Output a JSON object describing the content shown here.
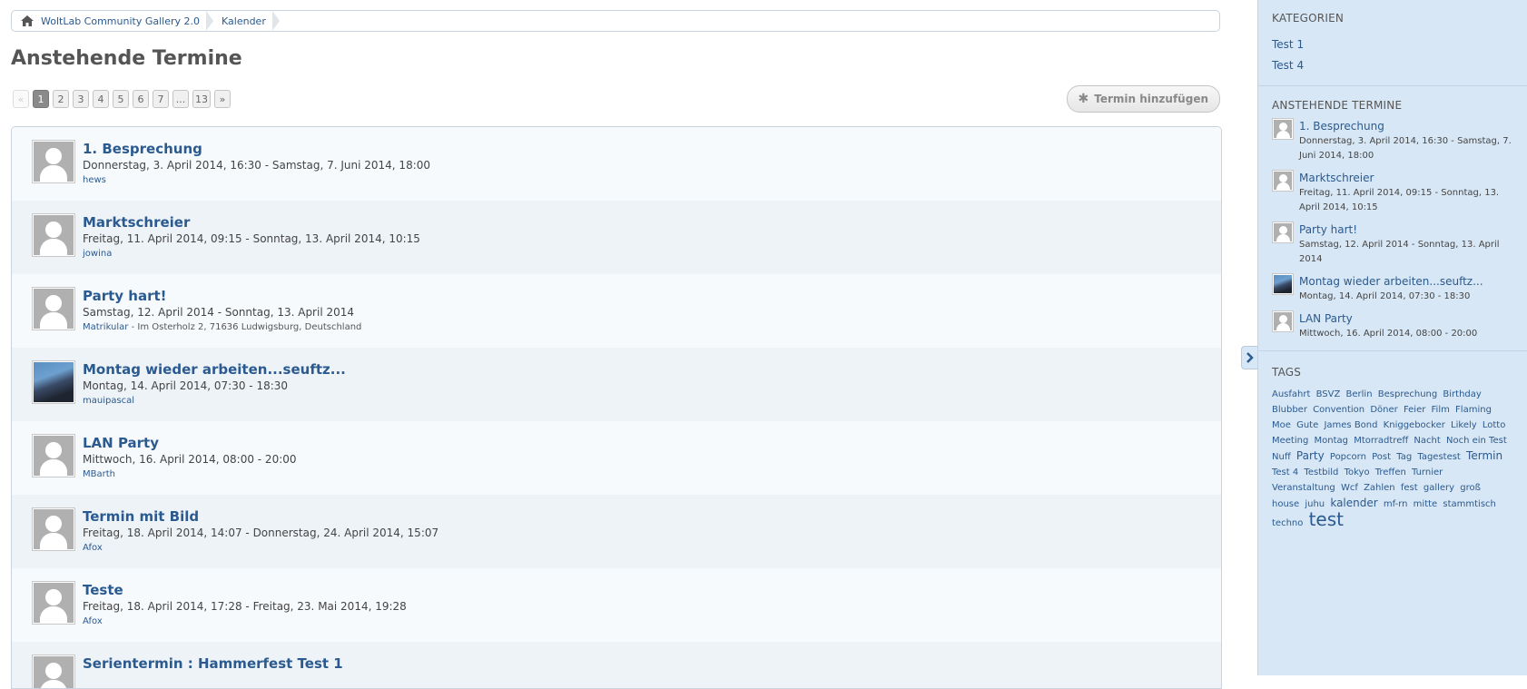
{
  "breadcrumb": {
    "items": [
      "WoltLab Community Gallery 2.0",
      "Kalender"
    ]
  },
  "page_title": "Anstehende Termine",
  "pagination": {
    "prev": "«",
    "pages": [
      "1",
      "2",
      "3",
      "4",
      "5",
      "6",
      "7",
      "...",
      "13"
    ],
    "active": "1",
    "next": "»"
  },
  "add_button": {
    "icon": "asterisk-icon",
    "label": "Termin hinzufügen"
  },
  "events": [
    {
      "title": "1. Besprechung",
      "date": "Donnerstag, 3. April 2014, 16:30 - Samstag, 7. Juni 2014, 18:00",
      "author": "hews",
      "location": ""
    },
    {
      "title": "Marktschreier",
      "date": "Freitag, 11. April 2014, 09:15 - Sonntag, 13. April 2014, 10:15",
      "author": "jowina",
      "location": ""
    },
    {
      "title": "Party hart!",
      "date": "Samstag, 12. April 2014 - Sonntag, 13. April 2014",
      "author": "Matrikular",
      "location": "- Im Osterholz 2, 71636 Ludwigsburg, Deutschland"
    },
    {
      "title": "Montag wieder arbeiten...seuftz...",
      "date": "Montag, 14. April 2014, 07:30 - 18:30",
      "author": "mauipascal",
      "location": ""
    },
    {
      "title": "LAN Party",
      "date": "Mittwoch, 16. April 2014, 08:00 - 20:00",
      "author": "MBarth",
      "location": ""
    },
    {
      "title": "Termin mit Bild",
      "date": "Freitag, 18. April 2014, 14:07 - Donnerstag, 24. April 2014, 15:07",
      "author": "Afox",
      "location": ""
    },
    {
      "title": "Teste",
      "date": "Freitag, 18. April 2014, 17:28 - Freitag, 23. Mai 2014, 19:28",
      "author": "Afox",
      "location": ""
    },
    {
      "title": "Serientermin : Hammerfest Test 1",
      "date": "",
      "author": "",
      "location": ""
    }
  ],
  "sidebar": {
    "categories_heading": "KATEGORIEN",
    "categories": [
      "Test 1",
      "Test 4"
    ],
    "upcoming_heading": "ANSTEHENDE TERMINE",
    "upcoming": [
      {
        "title": "1. Besprechung",
        "date": "Donnerstag, 3. April 2014, 16:30 - Samstag, 7. Juni 2014, 18:00"
      },
      {
        "title": "Marktschreier",
        "date": "Freitag, 11. April 2014, 09:15 - Sonntag, 13. April 2014, 10:15"
      },
      {
        "title": "Party hart!",
        "date": "Samstag, 12. April 2014 - Sonntag, 13. April 2014"
      },
      {
        "title": "Montag wieder arbeiten...seuftz...",
        "date": "Montag, 14. April 2014, 07:30 - 18:30"
      },
      {
        "title": "LAN Party",
        "date": "Mittwoch, 16. April 2014, 08:00 - 20:00"
      }
    ],
    "tags_heading": "TAGS",
    "tags": [
      {
        "t": "Ausfahrt",
        "s": 1
      },
      {
        "t": "BSVZ",
        "s": 1
      },
      {
        "t": "Berlin",
        "s": 1
      },
      {
        "t": "Besprechung",
        "s": 1
      },
      {
        "t": "Birthday",
        "s": 1
      },
      {
        "t": "Blubber",
        "s": 1
      },
      {
        "t": "Convention",
        "s": 1
      },
      {
        "t": "Döner",
        "s": 1
      },
      {
        "t": "Feier",
        "s": 1
      },
      {
        "t": "Film",
        "s": 1
      },
      {
        "t": "Flaming Moe",
        "s": 1
      },
      {
        "t": "Gute",
        "s": 1
      },
      {
        "t": "James Bond",
        "s": 1
      },
      {
        "t": "Kniggebocker",
        "s": 1
      },
      {
        "t": "Likely",
        "s": 1
      },
      {
        "t": "Lotto",
        "s": 1
      },
      {
        "t": "Meeting",
        "s": 1
      },
      {
        "t": "Montag",
        "s": 1
      },
      {
        "t": "Mtorradtreff",
        "s": 1
      },
      {
        "t": "Nacht",
        "s": 1
      },
      {
        "t": "Noch ein Test",
        "s": 1
      },
      {
        "t": "Nuff",
        "s": 1
      },
      {
        "t": "Party",
        "s": 2
      },
      {
        "t": "Popcorn",
        "s": 1
      },
      {
        "t": "Post",
        "s": 1
      },
      {
        "t": "Tag",
        "s": 1
      },
      {
        "t": "Tagestest",
        "s": 1
      },
      {
        "t": "Termin",
        "s": 2
      },
      {
        "t": "Test 4",
        "s": 1
      },
      {
        "t": "Testbild",
        "s": 1
      },
      {
        "t": "Tokyo",
        "s": 1
      },
      {
        "t": "Treffen",
        "s": 1
      },
      {
        "t": "Turnier",
        "s": 1
      },
      {
        "t": "Veranstaltung",
        "s": 1
      },
      {
        "t": "Wcf",
        "s": 1
      },
      {
        "t": "Zahlen",
        "s": 1
      },
      {
        "t": "fest",
        "s": 1
      },
      {
        "t": "gallery",
        "s": 1
      },
      {
        "t": "groß",
        "s": 1
      },
      {
        "t": "house",
        "s": 1
      },
      {
        "t": "juhu",
        "s": 1
      },
      {
        "t": "kalender",
        "s": 2
      },
      {
        "t": "mf-rn",
        "s": 1
      },
      {
        "t": "mitte",
        "s": 1
      },
      {
        "t": "stammtisch",
        "s": 1
      },
      {
        "t": "techno",
        "s": 1
      },
      {
        "t": "test",
        "s": 3
      }
    ]
  },
  "colors": {
    "link": "#2a5a8f",
    "sidebar_bg": "#d8e7f5",
    "row_odd": "#f7fafd",
    "row_even": "#eef3f8"
  }
}
